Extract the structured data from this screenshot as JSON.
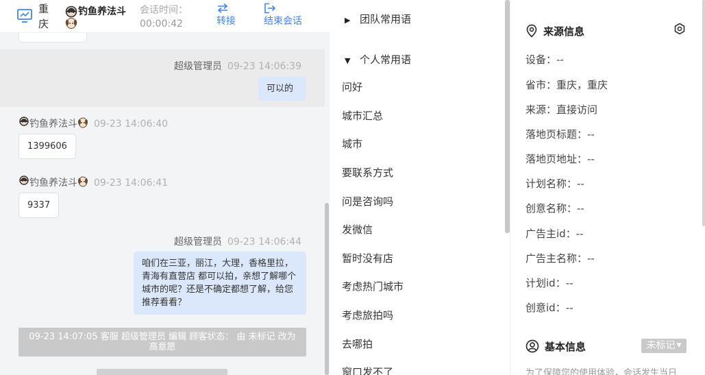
{
  "header": {
    "city": "重庆",
    "customer_name": "钓鱼养法斗",
    "session_time_label": "会话时间：",
    "session_time_value": "00:00:42",
    "transfer_label": "转接",
    "end_label": "结束会话",
    "accent": "#3f86e6"
  },
  "messages": [
    {
      "who": "超级管理员",
      "time": "09-23 14:06:39",
      "text": "可以的",
      "side": "self"
    },
    {
      "who": "钓鱼养法斗",
      "time": "09-23 14:06:40",
      "text": "1399606",
      "side": "peer"
    },
    {
      "who": "钓鱼养法斗",
      "time": "09-23 14:06:41",
      "text": "9337",
      "side": "peer"
    },
    {
      "who": "超级管理员",
      "time": "09-23 14:06:44",
      "text": "咱们在三亚，丽江，大理，香格里拉，青海有直营店 都可以拍，亲想了解哪个城市的呢？还是不确定都想了解，给您推荐看看？",
      "side": "self"
    }
  ],
  "system_note": "09-23 14:07:05 客服 超级管理员 编辑 顾客状态： 由 未标记 改为 高意愿",
  "phrases": {
    "team_group": "团队常用语",
    "personal_group": "个人常用语",
    "items": [
      "问好",
      "城市汇总",
      "城市",
      "要联系方式",
      "问是咨询吗",
      "发微信",
      "暂时没有店",
      "考虑热门城市",
      "考虑旅拍吗",
      "去哪拍",
      "窗口发不了"
    ]
  },
  "source_info": {
    "title": "来源信息",
    "fields": [
      "设备：--",
      "省市：重庆，重庆",
      "来源：直接访问",
      "落地页标题：--",
      "落地页地址：--",
      "计划名称：--",
      "创意名称：--",
      "广告主id：--",
      "广告主名称：--",
      "计划id：--",
      "创意id：--"
    ]
  },
  "basic_info": {
    "title": "基本信息",
    "tag_label": "未标记",
    "note": "为了保障您的使用体验，会话发生当日"
  },
  "colors": {
    "self_bubble": "#dbe8fb",
    "chat_bg": "#f3f4f6",
    "system_note_bg": "#c9c9c9"
  }
}
